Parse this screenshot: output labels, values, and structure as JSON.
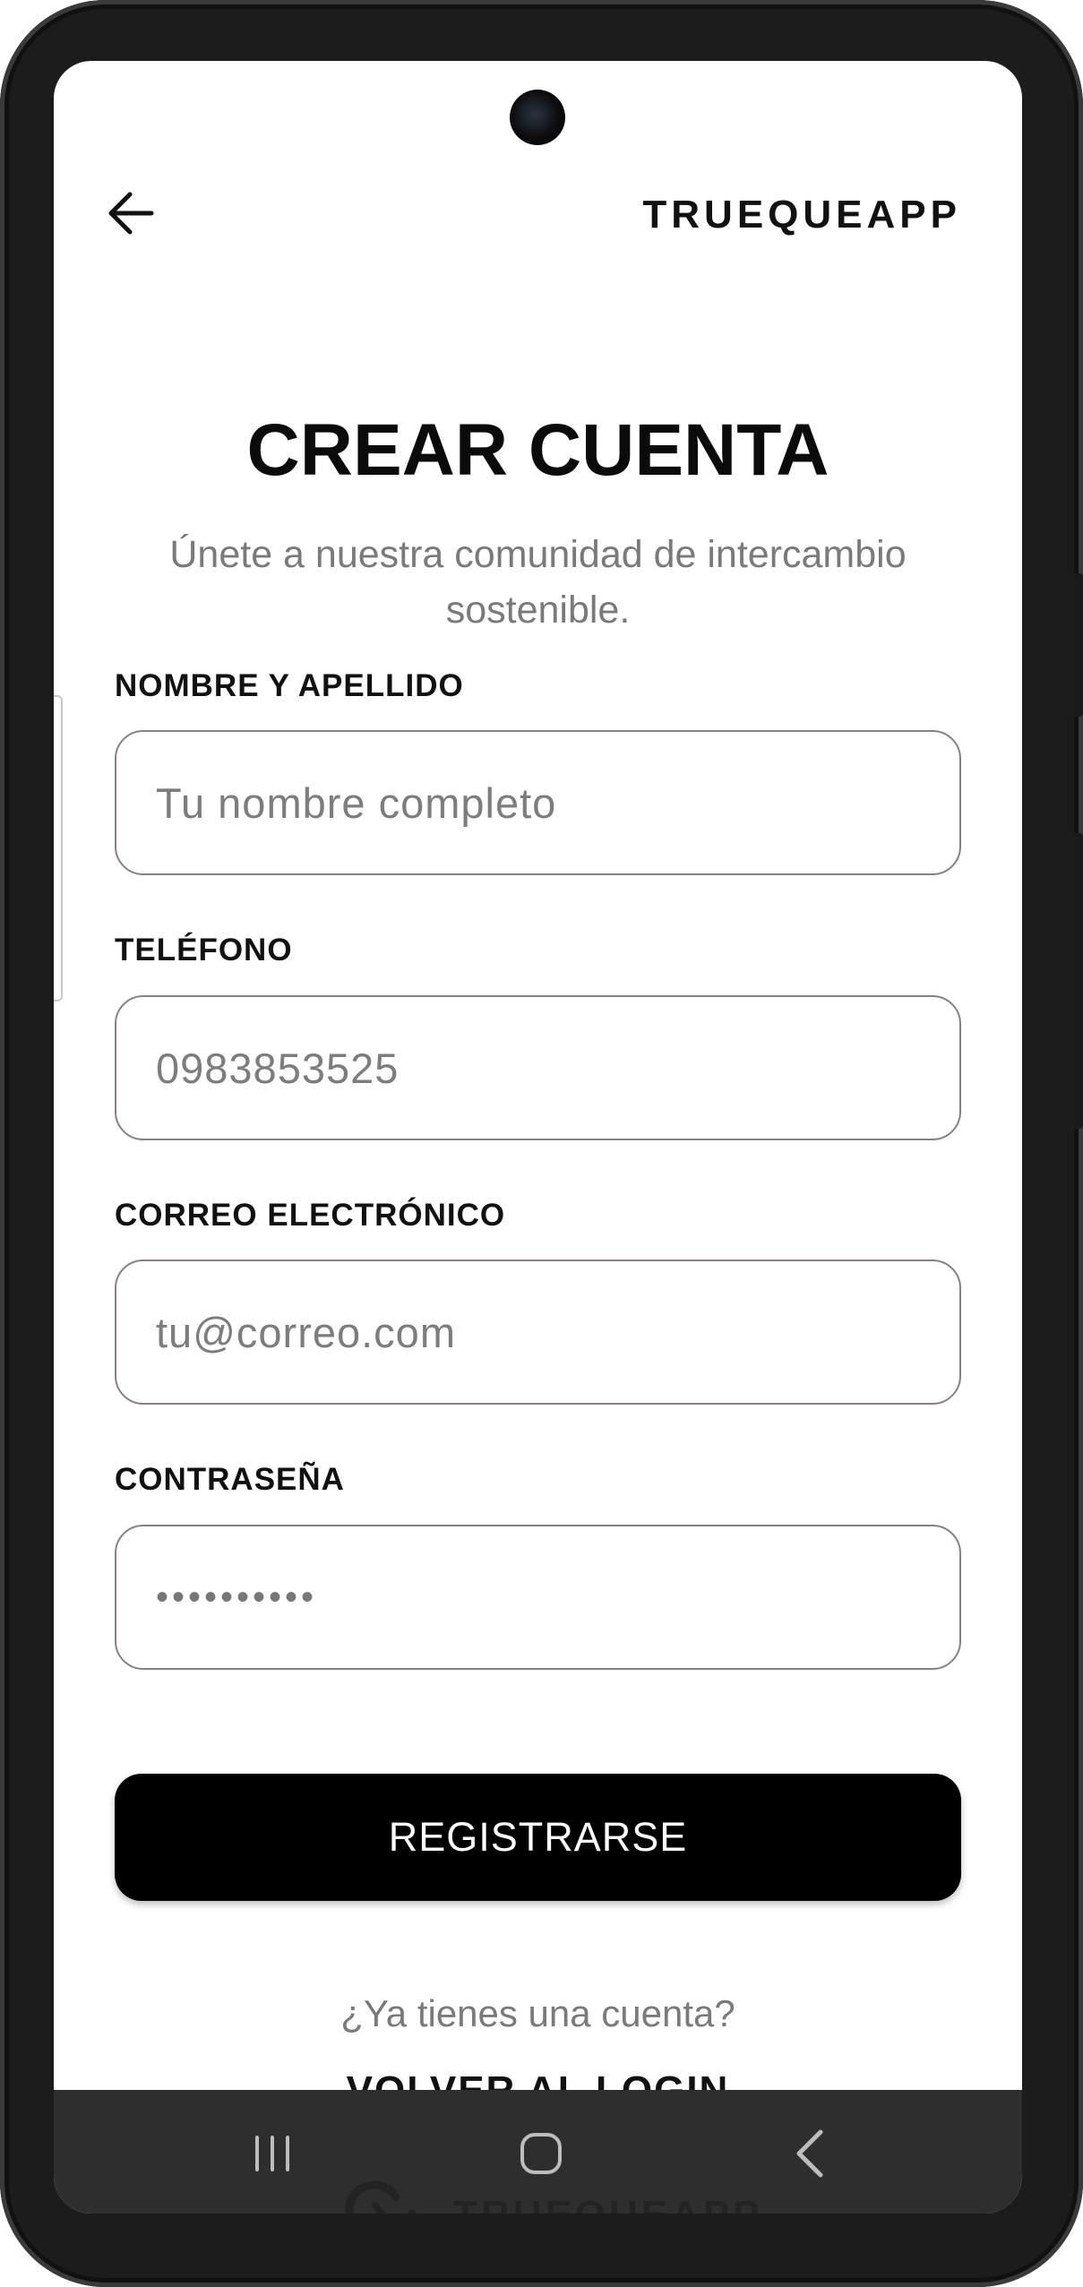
{
  "header": {
    "brand": "TRUEQUEAPP"
  },
  "page": {
    "title": "CREAR CUENTA",
    "subtitle": "Únete a nuestra comunidad de intercambio sostenible."
  },
  "form": {
    "name": {
      "label": "NOMBRE Y APELLIDO",
      "placeholder": "Tu nombre completo",
      "value": ""
    },
    "phone": {
      "label": "TELÉFONO",
      "placeholder": "0983853525",
      "value": ""
    },
    "email": {
      "label": "CORREO ELECTRÓNICO",
      "placeholder": "tu@correo.com",
      "value": ""
    },
    "password": {
      "label": "CONTRASEÑA",
      "value": "••••••••••"
    },
    "submit_label": "REGISTRARSE"
  },
  "footer": {
    "have_account": "¿Ya tienes una cuenta?",
    "login_link": "VOLVER AL LOGIN"
  },
  "watermark": {
    "text": "TRUEQUEAPP"
  },
  "icons": {
    "back": "arrow-left-icon",
    "nav_recent": "recent-apps-icon",
    "nav_home": "home-icon",
    "nav_back": "chevron-left-icon",
    "logo": "exchange-logo-icon"
  }
}
